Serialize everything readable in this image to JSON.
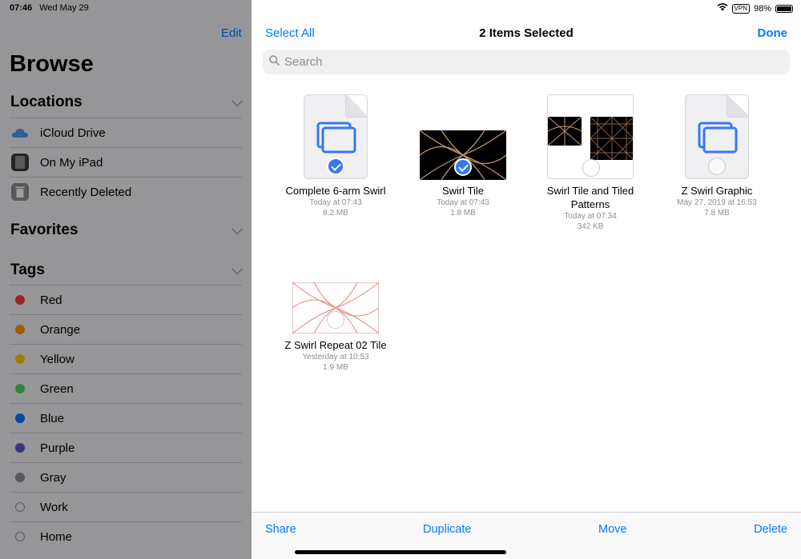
{
  "status_bar": {
    "time": "07:46",
    "date": "Wed May 29",
    "vpn": "VPN",
    "battery": "98%"
  },
  "sidebar": {
    "edit": "Edit",
    "title": "Browse",
    "locations": {
      "header": "Locations",
      "items": [
        {
          "label": "iCloud Drive",
          "icon": "cloud-icon"
        },
        {
          "label": "On My iPad",
          "icon": "ipad-icon"
        },
        {
          "label": "Recently Deleted",
          "icon": "trash-icon"
        }
      ]
    },
    "favorites": {
      "header": "Favorites"
    },
    "tags": {
      "header": "Tags",
      "items": [
        {
          "label": "Red",
          "color": "#ff3b30"
        },
        {
          "label": "Orange",
          "color": "#ff9500"
        },
        {
          "label": "Yellow",
          "color": "#ffcc00"
        },
        {
          "label": "Green",
          "color": "#4cd964"
        },
        {
          "label": "Blue",
          "color": "#007aff"
        },
        {
          "label": "Purple",
          "color": "#5856d6"
        },
        {
          "label": "Gray",
          "color": "#8e8e93"
        },
        {
          "label": "Work",
          "color": ""
        },
        {
          "label": "Home",
          "color": ""
        }
      ]
    }
  },
  "nav": {
    "select_all": "Select All",
    "title": "2 Items Selected",
    "done": "Done"
  },
  "search": {
    "placeholder": "Search"
  },
  "files": [
    {
      "name": "Complete 6-arm Swirl",
      "date": "Today at 07:43",
      "size": "8.2 MB",
      "selected": true
    },
    {
      "name": "Swirl Tile",
      "date": "Today at 07:43",
      "size": "1.8 MB",
      "selected": true
    },
    {
      "name": "Swirl Tile and Tiled Patterns",
      "date": "Today at 07:34",
      "size": "342 KB",
      "selected": false
    },
    {
      "name": "Z Swirl Graphic",
      "date": "May 27, 2019 at 16:53",
      "size": "7.8 MB",
      "selected": false
    },
    {
      "name": "Z Swirl Repeat 02 Tile",
      "date": "Yesterday at 10:53",
      "size": "1.9 MB",
      "selected": false
    }
  ],
  "toolbar": {
    "share": "Share",
    "duplicate": "Duplicate",
    "move": "Move",
    "delete": "Delete"
  },
  "colors": {
    "accent": "#007aff",
    "check": "#3478f6"
  }
}
